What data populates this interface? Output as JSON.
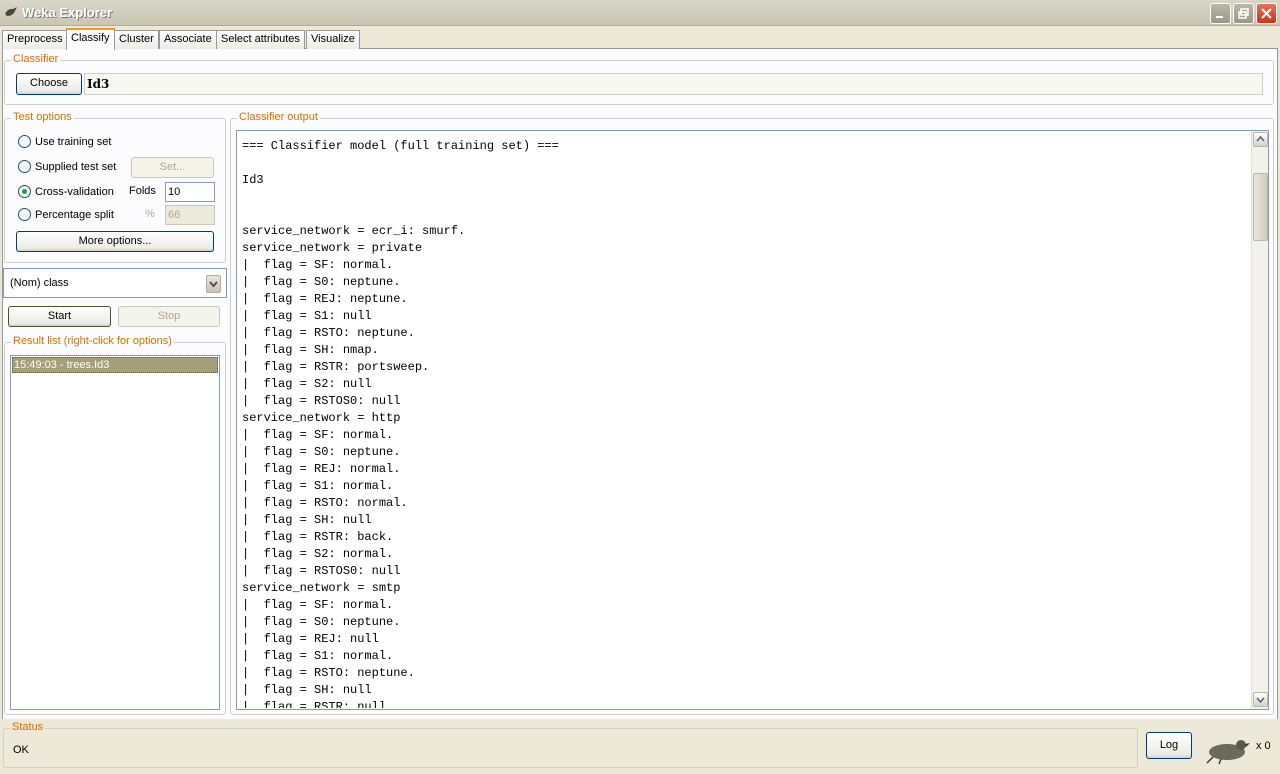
{
  "window": {
    "title": "Weka Explorer"
  },
  "tabs": [
    "Preprocess",
    "Classify",
    "Cluster",
    "Associate",
    "Select attributes",
    "Visualize"
  ],
  "classifier": {
    "legend": "Classifier",
    "choose_label": "Choose",
    "name": "Id3"
  },
  "test_options": {
    "legend": "Test options",
    "use_training_set": "Use training set",
    "supplied_test_set": "Supplied test set",
    "set_label": "Set...",
    "cross_validation": "Cross-validation",
    "folds_label": "Folds",
    "folds_value": "10",
    "percentage_split": "Percentage split",
    "percent_label": "%",
    "percent_value": "66",
    "selected": "cross_validation",
    "more_options_label": "More options..."
  },
  "class_select": {
    "value": "(Nom) class"
  },
  "run": {
    "start_label": "Start",
    "stop_label": "Stop"
  },
  "result_list": {
    "legend": "Result list (right-click for options)",
    "items": [
      "15:49:03 - trees.Id3"
    ]
  },
  "output": {
    "legend": "Classifier output",
    "lines": [
      "=== Classifier model (full training set) ===",
      "",
      "Id3",
      "",
      "",
      "service_network = ecr_i: smurf.",
      "service_network = private",
      "|  flag = SF: normal.",
      "|  flag = S0: neptune.",
      "|  flag = REJ: neptune.",
      "|  flag = S1: null",
      "|  flag = RSTO: neptune.",
      "|  flag = SH: nmap.",
      "|  flag = RSTR: portsweep.",
      "|  flag = S2: null",
      "|  flag = RSTOS0: null",
      "service_network = http",
      "|  flag = SF: normal.",
      "|  flag = S0: neptune.",
      "|  flag = REJ: normal.",
      "|  flag = S1: normal.",
      "|  flag = RSTO: normal.",
      "|  flag = SH: null",
      "|  flag = RSTR: back.",
      "|  flag = S2: normal.",
      "|  flag = RSTOS0: null",
      "service_network = smtp",
      "|  flag = SF: normal.",
      "|  flag = S0: neptune.",
      "|  flag = REJ: null",
      "|  flag = S1: normal.",
      "|  flag = RSTO: neptune.",
      "|  flag = SH: null",
      "|  flag = RSTR: null"
    ]
  },
  "status": {
    "legend": "Status",
    "text": "OK",
    "log_label": "Log",
    "task_count": "x 0"
  },
  "colors": {
    "legend_text": "#d66f00",
    "selected_result": "#a3a077",
    "active_tab_accent": "#ff9900"
  }
}
